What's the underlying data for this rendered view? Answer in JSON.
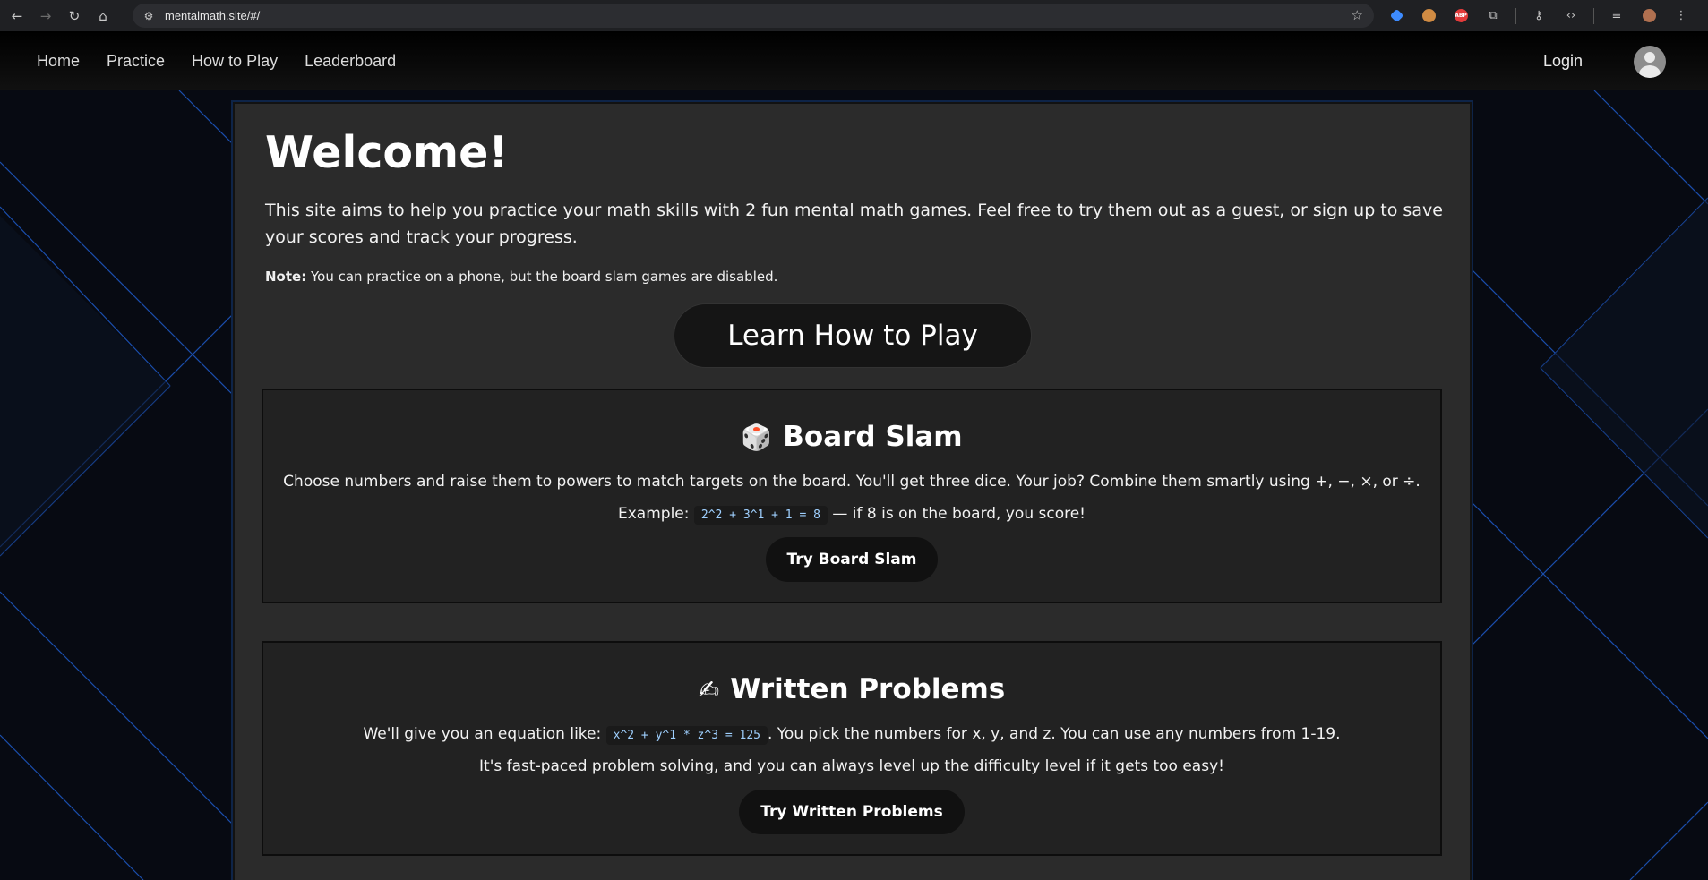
{
  "browser": {
    "url": "mentalmath.site/#/",
    "extension_colors": [
      "#3d8bff",
      "#d08b43",
      "#e33b3b"
    ],
    "abp_label": "ABP"
  },
  "nav": {
    "items": [
      "Home",
      "Practice",
      "How to Play",
      "Leaderboard"
    ],
    "login": "Login"
  },
  "main": {
    "title": "Welcome!",
    "intro": "This site aims to help you practice your math skills with 2 fun mental math games. Feel free to try them out as a guest, or sign up to save your scores and track your progress.",
    "note_label": "Note:",
    "note_text": " You can practice on a phone, but the board slam games are disabled.",
    "learn_button": "Learn How to Play"
  },
  "games": {
    "board_slam": {
      "emoji": "🎲",
      "title": "Board Slam",
      "description": "Choose numbers and raise them to powers to match targets on the board. You'll get three dice. Your job? Combine them smartly using +, −, ×, or ÷.",
      "example_label": "Example:",
      "example_code": "2^2 + 3^1 + 1 = 8",
      "example_suffix": "— if 8 is on the board, you score!",
      "button": "Try Board Slam"
    },
    "written": {
      "emoji": "✍",
      "title": "Written Problems",
      "desc_prefix": "We'll give you an equation like:",
      "desc_code": "x^2 + y^1 * z^3 = 125",
      "desc_suffix": ". You pick the numbers for x, y, and z. You can use any numbers from 1-19.",
      "desc2": "It's fast-paced problem solving, and you can always level up the difficulty level if it gets too easy!",
      "button": "Try Written Problems"
    }
  },
  "colors": {
    "accent_line": "#1e5ac8",
    "card": "#2b2b2b",
    "code_text": "#9fd0ff"
  }
}
